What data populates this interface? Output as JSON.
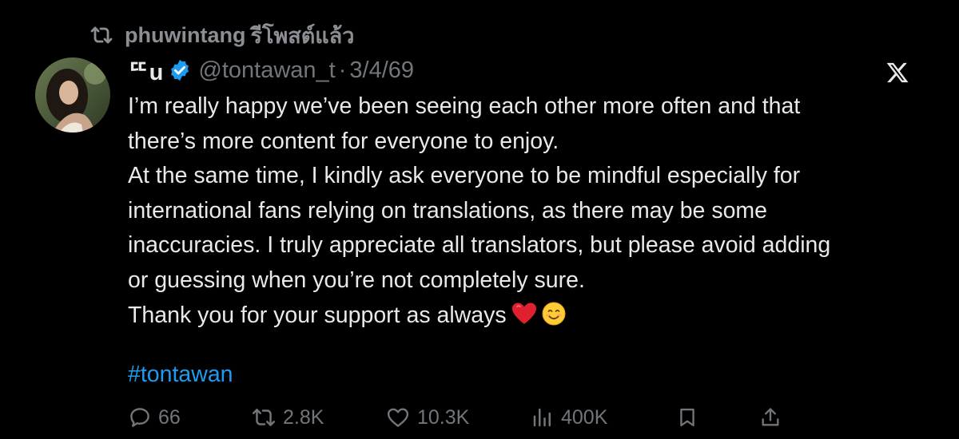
{
  "repost": {
    "user": "phuwintang",
    "label": "รีโพสต์แล้ว"
  },
  "author": {
    "display_name": "ᄄu",
    "handle": "@tontawan_t",
    "separator": "·",
    "date": "3/4/69",
    "verified": true
  },
  "tweet": {
    "lines": [
      "I’m really happy we’ve been seeing each other more often and that",
      "there’s more content for everyone to enjoy.",
      "At the same time, I kindly ask everyone to be mindful especially for",
      "international fans relying on translations, as there may be some",
      "inaccuracies. I truly appreciate all translators, but please avoid adding",
      "or guessing when you’re not completely sure.",
      "Thank you for your support as always"
    ],
    "emojis": [
      "red-heart",
      "smiling-face"
    ],
    "hashtag": "#tontawan"
  },
  "metrics": {
    "replies": "66",
    "reposts": "2.8K",
    "likes": "10.3K",
    "views": "400K"
  },
  "icons": {
    "repost": "repost-icon",
    "verified": "verified-badge-icon",
    "platform": "x-logo-icon",
    "reply": "reply-icon",
    "like": "heart-icon",
    "views": "views-icon",
    "bookmark": "bookmark-icon",
    "share": "share-icon"
  },
  "colors": {
    "background": "#000000",
    "text": "#e7e9ea",
    "muted": "#71767b",
    "accent": "#1d9bf0",
    "verified": "#1d9bf0"
  }
}
